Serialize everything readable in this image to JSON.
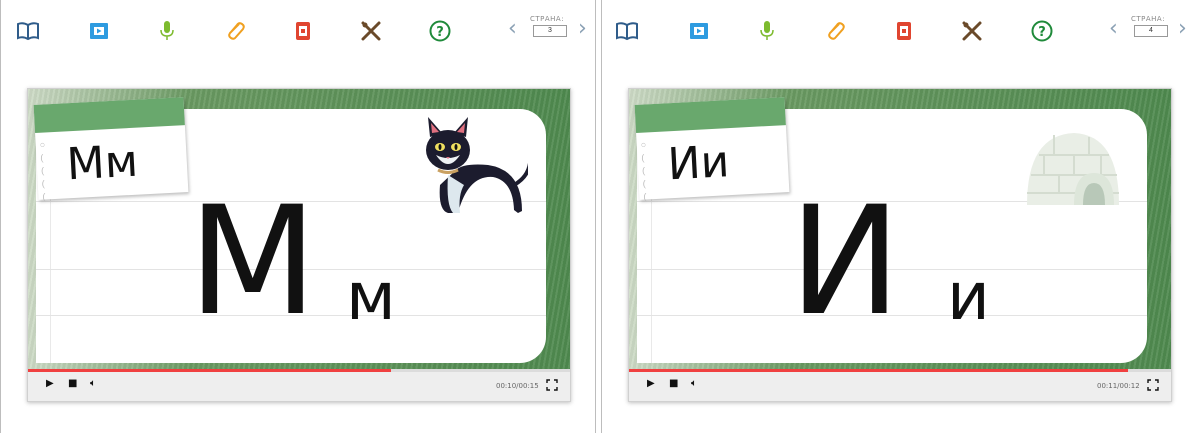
{
  "toolbar_icons": [
    {
      "name": "book-icon",
      "color": "#2f5c8a"
    },
    {
      "name": "film-icon",
      "color": "#2e9be0"
    },
    {
      "name": "microphone-icon",
      "color": "#7dbb2e"
    },
    {
      "name": "paperclip-icon",
      "color": "#f0a020"
    },
    {
      "name": "document-icon",
      "color": "#e04530"
    },
    {
      "name": "tools-icon",
      "color": "#6a4a2a"
    },
    {
      "name": "help-icon",
      "color": "#1f8a3a"
    }
  ],
  "colors": {
    "progress": "#f04040",
    "note_header": "#69a86d",
    "grass": "#4f8a4f",
    "pager_arrow": "#8aa0b4"
  },
  "panels": [
    {
      "pager": {
        "label": "СТРАНА:",
        "page": "3"
      },
      "note_letters": "Мм",
      "big_upper": "М",
      "big_lower": "м",
      "illustration": "cat",
      "time": "00:10/00:15",
      "progress": 0.67
    },
    {
      "pager": {
        "label": "СТРАНА:",
        "page": "4"
      },
      "note_letters": "Ии",
      "big_upper": "И",
      "big_lower": "и",
      "illustration": "igloo",
      "time": "00:11/00:12",
      "progress": 0.92
    }
  ]
}
